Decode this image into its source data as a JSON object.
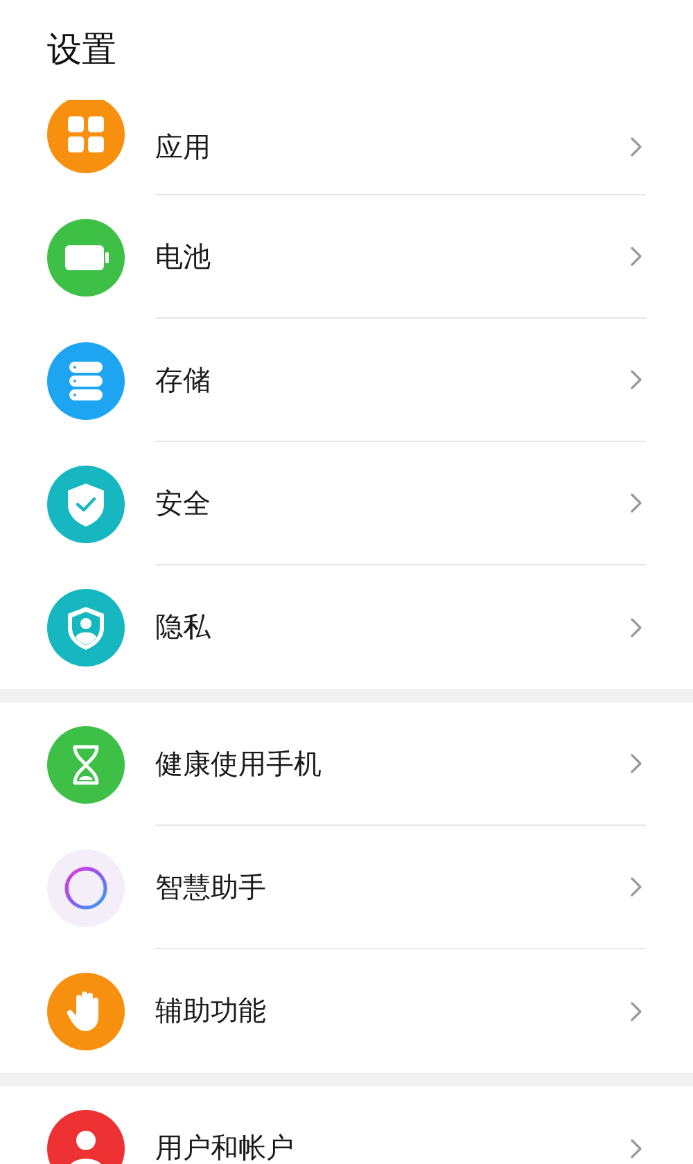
{
  "title": "设置",
  "groups": [
    {
      "items": [
        {
          "label": "应用",
          "kind": "apps",
          "color": "#f7900f"
        },
        {
          "label": "电池",
          "kind": "battery",
          "color": "#3ec047"
        },
        {
          "label": "存储",
          "kind": "storage",
          "color": "#1ea5f2"
        },
        {
          "label": "安全",
          "kind": "security",
          "color": "#16b7c0"
        },
        {
          "label": "隐私",
          "kind": "privacy",
          "color": "#16b7c0"
        }
      ]
    },
    {
      "items": [
        {
          "label": "健康使用手机",
          "kind": "hourglass",
          "color": "#3ec047"
        },
        {
          "label": "智慧助手",
          "kind": "assistant",
          "color": "#f3eef8"
        },
        {
          "label": "辅助功能",
          "kind": "hand",
          "color": "#f7900f"
        }
      ]
    },
    {
      "items": [
        {
          "label": "用户和帐户",
          "kind": "user",
          "color": "#ee3233"
        }
      ]
    }
  ]
}
